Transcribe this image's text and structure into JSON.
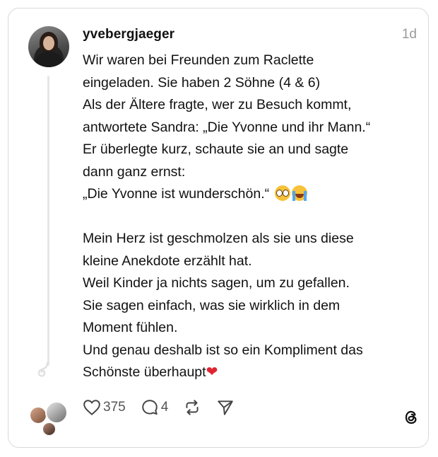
{
  "post": {
    "username": "yvebergjaeger",
    "time": "1d",
    "text_lines": [
      "Wir waren bei Freunden zum Raclette",
      "eingeladen. Sie haben 2 Söhne (4 & 6)",
      "Als der Ältere fragte, wer zu Besuch kommt,",
      "antwortete Sandra: „Die Yvonne und ihr Mann.“",
      "Er überlegte kurz, schaute sie an und sagte",
      "dann ganz ernst:",
      "„Die Yvonne ist wunderschön.“",
      "",
      "Mein Herz ist geschmolzen als sie uns diese",
      "kleine Anekdote erzählt hat.",
      "Weil Kinder ja nichts sagen, um zu gefallen.",
      "Sie sagen einfach, was sie wirklich in dem",
      "Moment fühlen.",
      "Und genau deshalb ist so ein Kompliment das",
      "Schönste überhaupt"
    ],
    "emojis": [
      "pleading-face",
      "loudly-crying-face",
      "red-heart"
    ]
  },
  "actions": {
    "likes": "375",
    "replies": "4"
  },
  "icons": [
    "heart-icon",
    "comment-icon",
    "repost-icon",
    "share-icon",
    "threads-logo-icon"
  ]
}
